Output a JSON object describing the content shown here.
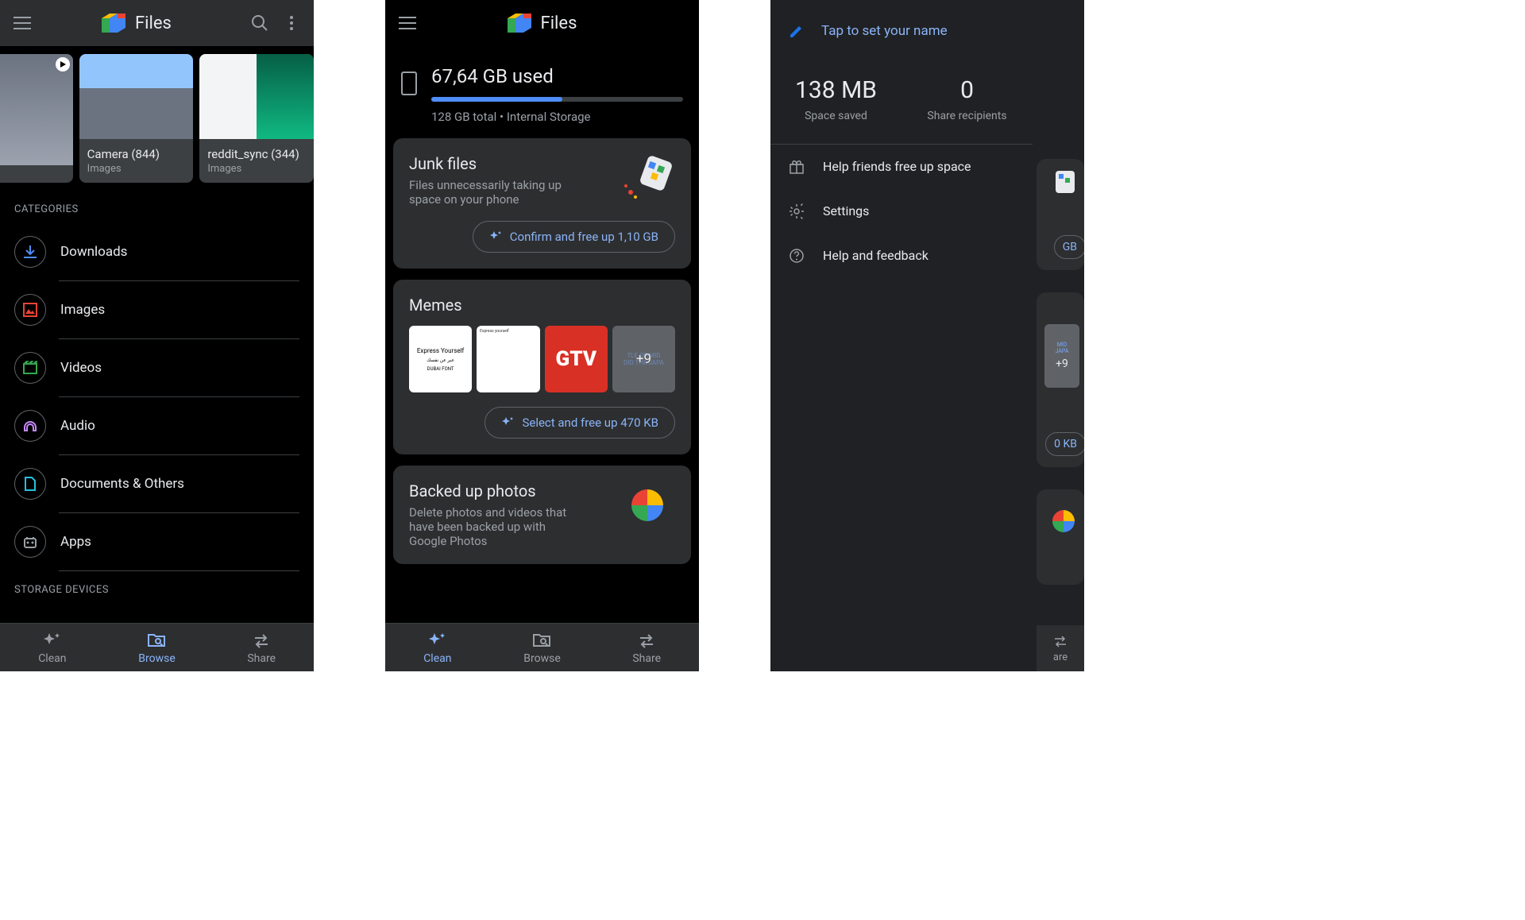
{
  "app_title": "Files",
  "s1": {
    "recent": [
      {
        "title": "",
        "subtitle": ""
      },
      {
        "title": "Camera (844)",
        "subtitle": "Images"
      },
      {
        "title": "reddit_sync (344)",
        "subtitle": "Images"
      }
    ],
    "categories_label": "CATEGORIES",
    "categories": [
      {
        "label": "Downloads",
        "icon": "download",
        "color": "#4f8df7"
      },
      {
        "label": "Images",
        "icon": "image",
        "color": "#ea4335"
      },
      {
        "label": "Videos",
        "icon": "video",
        "color": "#34a853"
      },
      {
        "label": "Audio",
        "icon": "audio",
        "color": "#c58af9"
      },
      {
        "label": "Documents & Others",
        "icon": "document",
        "color": "#24c1e0"
      },
      {
        "label": "Apps",
        "icon": "apps",
        "color": "#9aa0a6"
      }
    ],
    "storage_devices_label": "STORAGE DEVICES",
    "nav": {
      "clean": "Clean",
      "browse": "Browse",
      "share": "Share",
      "active": "browse"
    }
  },
  "s2": {
    "storage_used": "67,64 GB used",
    "storage_total": "128 GB total • Internal Storage",
    "storage_pct": 52,
    "cards": {
      "junk": {
        "title": "Junk files",
        "subtitle": "Files unnecessarily taking up space on your phone",
        "button": "Confirm and free up 1,10 GB"
      },
      "memes": {
        "title": "Memes",
        "button": "Select and free up 470 KB",
        "overlay": "+9",
        "meme1_line1": "Express Yourself",
        "meme1_line3": "DUBAI FONT",
        "meme2_line1": "Express yourself",
        "meme3": "GTV",
        "meme4_line1": "TLE OF MID",
        "meme4_line2": "DID THE JAPA"
      },
      "photos": {
        "title": "Backed up photos",
        "subtitle": "Delete photos and videos that have been backed up with Google Photos"
      }
    },
    "nav": {
      "clean": "Clean",
      "browse": "Browse",
      "share": "Share",
      "active": "clean"
    }
  },
  "s3": {
    "name_prompt": "Tap to set your name",
    "stats": {
      "saved_num": "138 MB",
      "saved_label": "Space saved",
      "recip_num": "0",
      "recip_label": "Share recipients"
    },
    "items": [
      {
        "label": "Help friends free up space",
        "icon": "gift"
      },
      {
        "label": "Settings",
        "icon": "gear"
      },
      {
        "label": "Help and feedback",
        "icon": "help"
      }
    ],
    "peek": {
      "gb": "GB",
      "kb": "0 KB",
      "share": "are"
    }
  }
}
